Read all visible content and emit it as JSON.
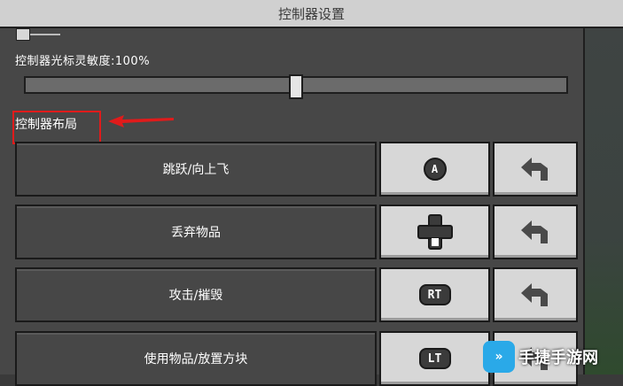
{
  "window": {
    "title": "控制器设置"
  },
  "sensitivity": {
    "label": "控制器光标灵敏度:100%",
    "value_fraction": 0.5
  },
  "layout_section": {
    "title": "控制器布局"
  },
  "bindings": [
    {
      "action": "跳跃/向上飞",
      "key_icon": "a-button-icon",
      "key_label": "A",
      "reset_icon": "reset-arrow-icon"
    },
    {
      "action": "丢弃物品",
      "key_icon": "dpad-down-icon",
      "key_label": "",
      "reset_icon": "reset-arrow-icon"
    },
    {
      "action": "攻击/摧毁",
      "key_icon": "rt-trigger-icon",
      "key_label": "RT",
      "reset_icon": "reset-arrow-icon"
    },
    {
      "action": "使用物品/放置方块",
      "key_icon": "lt-trigger-icon",
      "key_label": "LT",
      "reset_icon": "reset-arrow-icon"
    }
  ],
  "watermark": {
    "text": "手捷手游网"
  },
  "colors": {
    "highlight": "#e01b1b",
    "panel": "#474747",
    "key_bg": "#d7d7d7"
  }
}
